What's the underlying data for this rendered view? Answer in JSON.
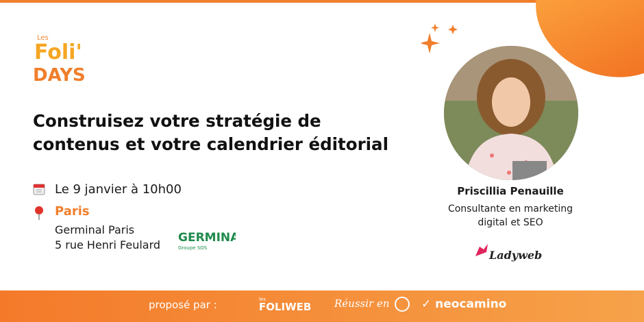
{
  "logo": {
    "brand_small": "Les",
    "brand_main_1": "Foli'",
    "brand_main_2": "DAYS",
    "icon": "foli-days-logo"
  },
  "event": {
    "title_line1": "Construisez votre stratégie de",
    "title_line2": "contenus et votre calendrier éditorial",
    "date": "Le 9 janvier à 10h00",
    "city": "Paris",
    "venue_line1": "Germinal Paris",
    "venue_line2": "5 rue Henri Feulard",
    "date_icon": "calendar-icon",
    "location_icon": "location-pin-icon"
  },
  "partner": {
    "name": "GERMINAL",
    "sub": "Groupe SOS"
  },
  "speaker": {
    "name": "Priscillia Penauille",
    "role_line1": "Consultante en marketing",
    "role_line2": "digital et SEO",
    "company": "Ladyweb"
  },
  "footer": {
    "proposed_by": "proposé par :",
    "sponsor1_small": "les",
    "sponsor1": "FOLIWEB",
    "sponsor2": "Réussir en",
    "sponsor3": "neocamino"
  },
  "colors": {
    "accent": "#f07e2b",
    "footer_start": "#f47a2a",
    "footer_end": "#f6a24a",
    "text": "#1a1a1a"
  }
}
